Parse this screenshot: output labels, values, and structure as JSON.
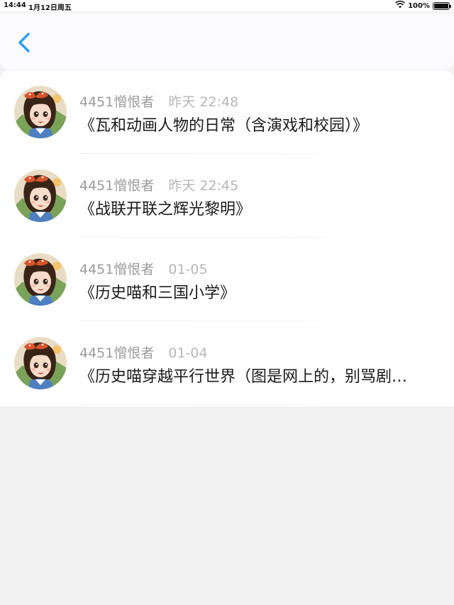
{
  "status_bar": {
    "time": "14:44",
    "date": "1月12日周五",
    "battery_percent": "100%",
    "battery_level": 1.0
  },
  "nav": {
    "back_icon": "chevron-left-icon",
    "accent_color": "#2d9cf0"
  },
  "items": [
    {
      "user": "4451憎恨者",
      "time": "昨天 22:48",
      "title": "《瓦和动画人物的日常（含演戏和校园）》"
    },
    {
      "user": "4451憎恨者",
      "time": "昨天 22:45",
      "title": "《战联开联之辉光黎明》"
    },
    {
      "user": "4451憎恨者",
      "time": "01-05",
      "title": "《历史喵和三国小学》"
    },
    {
      "user": "4451憎恨者",
      "time": "01-04",
      "title": "《历史喵穿越平行世界（图是网上的，别骂剧…"
    }
  ]
}
